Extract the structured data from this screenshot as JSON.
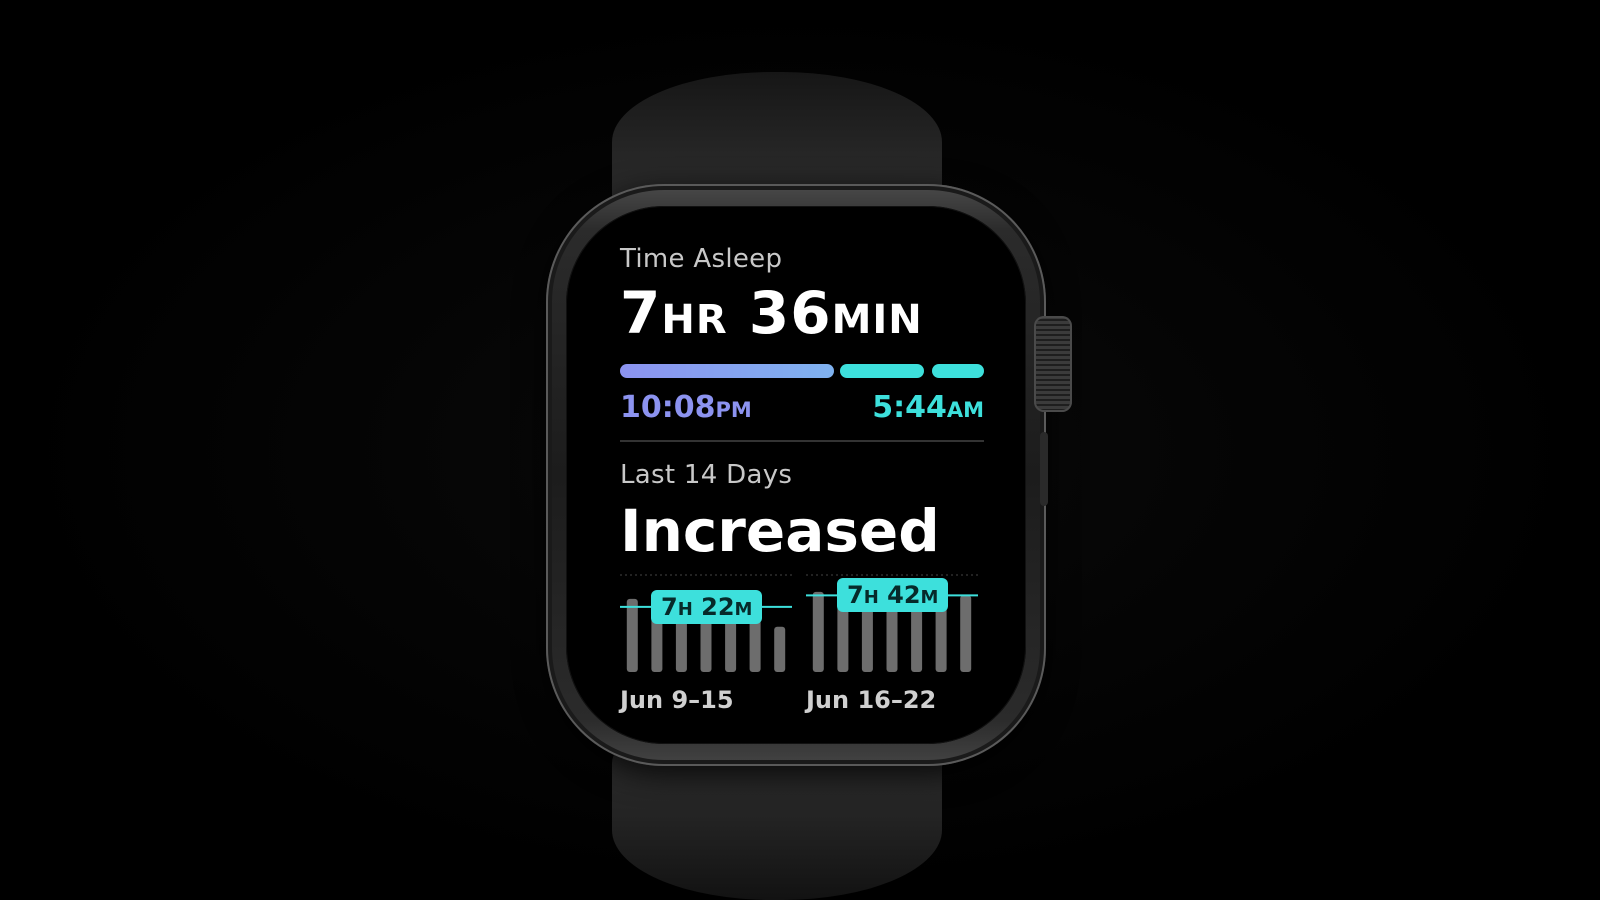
{
  "time_asleep": {
    "label": "Time Asleep",
    "hours": "7",
    "hours_unit": "HR",
    "minutes": "36",
    "minutes_unit": "MIN",
    "start_time": "10:08",
    "start_suffix": "PM",
    "end_time": "5:44",
    "end_suffix": "AM"
  },
  "trend": {
    "label": "Last 14 Days",
    "value": "Increased"
  },
  "weeks": [
    {
      "range": "Jun 9–15",
      "avg_hours": "7",
      "avg_h_unit": "H",
      "avg_minutes": "22",
      "avg_m_unit": "M"
    },
    {
      "range": "Jun 16–22",
      "avg_hours": "7",
      "avg_h_unit": "H",
      "avg_minutes": "42",
      "avg_m_unit": "M"
    }
  ],
  "chart_data": [
    {
      "type": "bar",
      "values": [
        7.6,
        7.7,
        7.5,
        7.8,
        7.2,
        7.0,
        6.8
      ],
      "average": 7.37
    },
    {
      "type": "bar",
      "values": [
        7.8,
        7.9,
        7.7,
        7.4,
        7.6,
        7.5,
        7.7
      ],
      "average": 7.7
    }
  ],
  "colors": {
    "asleep_purple": "#8c93f0",
    "asleep_teal": "#3de0dc",
    "bar_gray": "#6d6d6d"
  }
}
